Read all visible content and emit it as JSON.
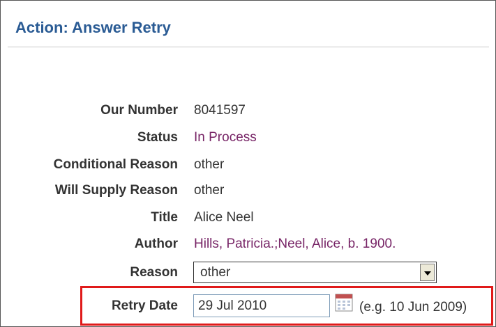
{
  "header": {
    "title": "Action: Answer Retry"
  },
  "fields": [
    {
      "label": "Our Number",
      "value": "8041597"
    },
    {
      "label": "Status",
      "value": "In Process"
    },
    {
      "label": "Conditional Reason",
      "value": "other"
    },
    {
      "label": "Will Supply Reason",
      "value": "other"
    },
    {
      "label": "Title",
      "value": "Alice Neel"
    },
    {
      "label": "Author",
      "value": "Hills, Patricia.;Neel, Alice, b. 1900."
    }
  ],
  "reason": {
    "label": "Reason",
    "selected": "other"
  },
  "retry_date": {
    "label": "Retry Date",
    "value": "29 Jul 2010",
    "hint": "(e.g. 10 Jun 2009)",
    "icon": "calendar-icon"
  },
  "colors": {
    "title": "#2a5b94",
    "link_value": "#772466",
    "highlight": "#e01a1a"
  }
}
